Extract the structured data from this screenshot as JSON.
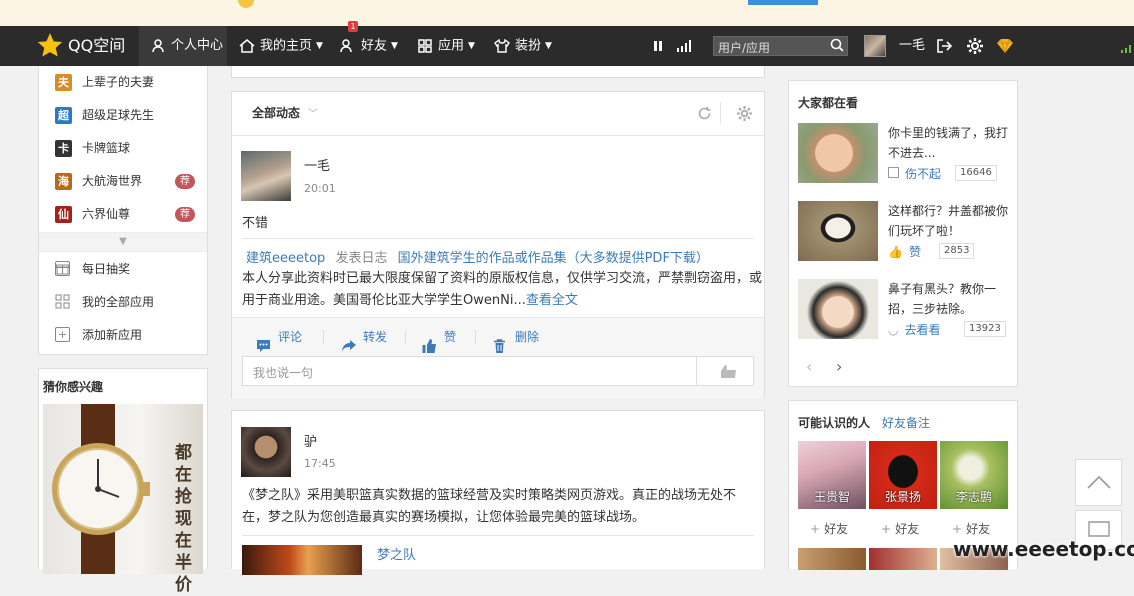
{
  "nav": {
    "logo": "QQ空间",
    "items": [
      {
        "label": "个人中心",
        "icon": "person-icon"
      },
      {
        "label": "我的主页",
        "icon": "home-icon"
      },
      {
        "label": "好友",
        "icon": "friends-icon",
        "badge": "1"
      },
      {
        "label": "应用",
        "icon": "apps-grid-icon"
      },
      {
        "label": "装扮",
        "icon": "tshirt-icon"
      }
    ],
    "search_placeholder": "用户/应用",
    "username": "一毛"
  },
  "left_apps": [
    {
      "label": "上辈子的夫妻",
      "icon": "couple-app-icon",
      "color": "#d98a2b",
      "glyph": "夫"
    },
    {
      "label": "超级足球先生",
      "icon": "football-app-icon",
      "color": "#2f78c4",
      "glyph": "超"
    },
    {
      "label": "卡牌篮球",
      "icon": "card-basketball-icon",
      "color": "#333333",
      "glyph": "卡"
    },
    {
      "label": "大航海世界",
      "icon": "voyage-app-icon",
      "color": "#b56a1f",
      "glyph": "海"
    },
    {
      "label": "六界仙尊",
      "icon": "immortal-app-icon",
      "color": "#a0241e",
      "glyph": "仙"
    }
  ],
  "recommend_badge": "荐",
  "left_tools": [
    {
      "label": "每日抽奖",
      "icon": "gift-icon",
      "glyph": "礼"
    },
    {
      "label": "我的全部应用",
      "icon": "all-apps-icon",
      "glyph": "▦"
    },
    {
      "label": "添加新应用",
      "icon": "add-app-icon",
      "glyph": "+"
    }
  ],
  "interest": {
    "title": "猜你感兴趣",
    "ad_text": "都在抢 现在半价"
  },
  "feed": {
    "filter_label": "全部动态",
    "posts": [
      {
        "author": "一毛",
        "time": "20:01",
        "text": "不错",
        "share_source": "建筑eeeetop",
        "share_action": "发表日志",
        "share_title": "国外建筑学生的作品或作品集（大多数提供PDF下载）",
        "share_body": "本人分享此资料时已最大限度保留了资料的原版权信息，仅供学习交流，严禁剽窃盗用，或用于商业用途。美国哥伦比亚大学学生OwenNi...",
        "read_more": "查看全文"
      },
      {
        "author": "驴",
        "time": "17:45",
        "text": "《梦之队》采用美职篮真实数据的篮球经营及实时策略类网页游戏。真正的战场无处不在，梦之队为您创造最真实的赛场模拟，让您体验最完美的篮球战场。",
        "link_title": "梦之队"
      }
    ],
    "actions": [
      {
        "label": "评论",
        "icon": "comment-icon"
      },
      {
        "label": "转发",
        "icon": "forward-icon"
      },
      {
        "label": "赞",
        "icon": "like-icon"
      },
      {
        "label": "删除",
        "icon": "trash-icon"
      }
    ],
    "reply_placeholder": "我也说一句"
  },
  "watching": {
    "title": "大家都在看",
    "items": [
      {
        "title": "你卡里的钱满了，我打不进去...",
        "stat": "伤不起",
        "count": "16646",
        "stat_icon": "hurt-icon"
      },
      {
        "title": "这样都行？井盖都被你们玩坏了啦！",
        "stat": "赞",
        "count": "2853",
        "stat_icon": "thumb-icon"
      },
      {
        "title": "鼻子有黑头？教你一招，三步祛除。",
        "stat": "去看看",
        "count": "13923",
        "stat_icon": "smile-icon"
      }
    ]
  },
  "friends": {
    "title": "可能认识的人",
    "link": "好友备注",
    "people": [
      {
        "name": "王贵智"
      },
      {
        "name": "张景扬"
      },
      {
        "name": "李志鹏"
      }
    ],
    "add_label": "好友"
  },
  "watermark": "www.eeeetop.com"
}
